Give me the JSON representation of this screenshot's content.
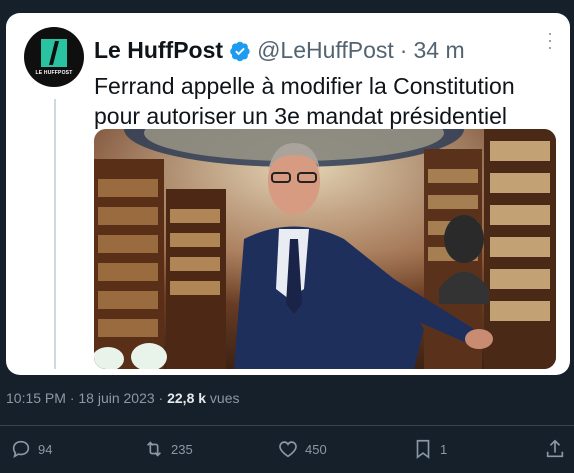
{
  "tweet_card": {
    "avatar_brand": "LE HUFFPOST",
    "author_name": "Le HuffPost",
    "handle": "@LeHuffPost",
    "separator": "·",
    "time_ago": "34 m",
    "text": "Ferrand appelle à modifier la Constitution pour autoriser un 3e mandat présidentiel",
    "colors": {
      "brand_accent": "#2ac3a2",
      "verified": "#1d9bf0"
    },
    "icons": [
      "verified-badge-icon",
      "more-options-icon"
    ]
  },
  "meta": {
    "timestamp": "10:15 PM · 18 juin 2023 · ",
    "views_count": "22,8 k",
    "views_label": " vues"
  },
  "actions": {
    "replies": "94",
    "reposts": "235",
    "likes": "450",
    "bookmarks": "1",
    "icons": [
      "reply-icon",
      "repost-icon",
      "like-icon",
      "bookmark-icon",
      "share-icon"
    ]
  }
}
